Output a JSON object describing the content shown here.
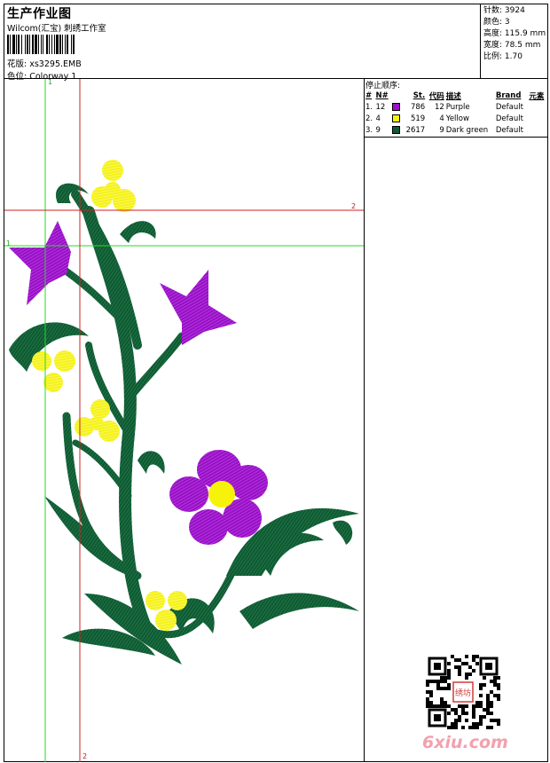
{
  "header": {
    "title": "生产作业图",
    "company": "Wilcom(汇宝) 刺绣工作室",
    "design_label": "花版:",
    "design_value": "xs3295.EMB",
    "colorway_label": "色位:",
    "colorway_value": "Colorway 1"
  },
  "stats": [
    {
      "label": "针数:",
      "value": "3924"
    },
    {
      "label": "颜色:",
      "value": "3"
    },
    {
      "label": "高度:",
      "value": "115.9 mm"
    },
    {
      "label": "宽度:",
      "value": "78.5 mm"
    },
    {
      "label": "比例:",
      "value": "1.70"
    }
  ],
  "stop_sequence": {
    "title": "停止顺序:",
    "headers": [
      "#",
      "N#",
      "St.",
      "代码",
      "描述",
      "Brand",
      "元素"
    ],
    "rows": [
      {
        "index": "1.",
        "n": "12",
        "color": "#9a10c8",
        "stitches": "786",
        "code": "12",
        "desc": "Purple",
        "brand": "Default"
      },
      {
        "index": "2.",
        "n": "4",
        "color": "#f7f20a",
        "stitches": "519",
        "code": "4",
        "desc": "Yellow",
        "brand": "Default"
      },
      {
        "index": "3.",
        "n": "9",
        "color": "#0f5a33",
        "stitches": "2617",
        "code": "9",
        "desc": "Dark green",
        "brand": "Default"
      }
    ]
  },
  "guides": {
    "green_top": "1",
    "green_left": "1",
    "red_right": "2",
    "red_bottom": "2"
  },
  "colors": {
    "purple": "#9a10c8",
    "yellow": "#f5f21a",
    "green": "#0f5a33",
    "guide_green": "#22dd22",
    "guide_red": "#cc2222",
    "watermark": "#f2a1ad"
  },
  "watermark": {
    "brand": "6xiu.com",
    "qr_seal": "绣坊"
  }
}
